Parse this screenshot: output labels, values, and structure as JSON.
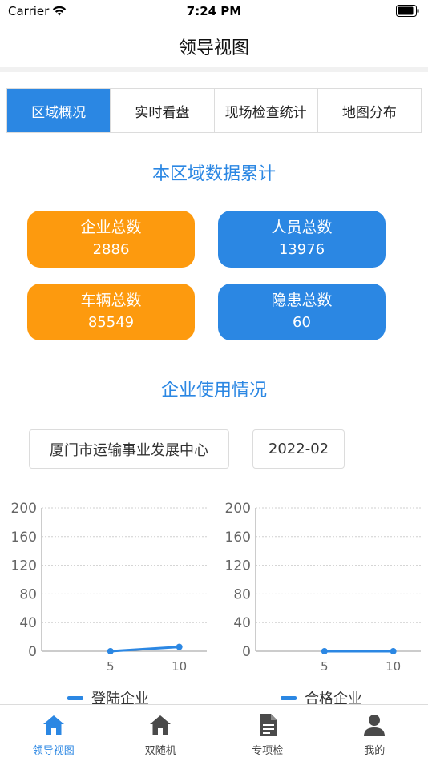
{
  "status_bar": {
    "carrier": "Carrier",
    "time": "7:24 PM"
  },
  "header": {
    "title": "领导视图"
  },
  "tabs": [
    {
      "label": "区域概况",
      "active": true
    },
    {
      "label": "实时看盘",
      "active": false
    },
    {
      "label": "现场检查统计",
      "active": false
    },
    {
      "label": "地图分布",
      "active": false
    }
  ],
  "region_summary": {
    "title": "本区域数据累计",
    "cards": [
      {
        "label": "企业总数",
        "value": "2886",
        "color": "#fd9a0e"
      },
      {
        "label": "人员总数",
        "value": "13976",
        "color": "#2b87e3"
      },
      {
        "label": "车辆总数",
        "value": "85549",
        "color": "#fd9a0e"
      },
      {
        "label": "隐患总数",
        "value": "60",
        "color": "#2b87e3"
      }
    ]
  },
  "usage": {
    "title": "企业使用情况",
    "org_select": "厦门市运输事业发展中心",
    "date_select": "2022-02"
  },
  "colors": {
    "accent": "#2b87e3",
    "orange": "#fd9a0e"
  },
  "chart_data": [
    {
      "type": "line",
      "x": [
        5,
        10
      ],
      "series": [
        {
          "name": "登陆企业",
          "values": [
            0,
            6
          ]
        }
      ],
      "ylim": [
        0,
        200
      ],
      "yticks": [
        0,
        40,
        80,
        120,
        160,
        200
      ],
      "xticks": [
        5,
        10
      ],
      "xrange": [
        0,
        12
      ],
      "grid": true,
      "legend": "bottom"
    },
    {
      "type": "line",
      "x": [
        5,
        10
      ],
      "series": [
        {
          "name": "合格企业",
          "values": [
            0,
            0
          ]
        }
      ],
      "ylim": [
        0,
        200
      ],
      "yticks": [
        0,
        40,
        80,
        120,
        160,
        200
      ],
      "xticks": [
        5,
        10
      ],
      "xrange": [
        0,
        12
      ],
      "grid": true,
      "legend": "bottom"
    }
  ],
  "tab_bar": [
    {
      "label": "领导视图",
      "icon": "home-icon",
      "active": true
    },
    {
      "label": "双随机",
      "icon": "home-icon",
      "active": false
    },
    {
      "label": "专项检",
      "icon": "document-icon",
      "active": false
    },
    {
      "label": "我的",
      "icon": "user-icon",
      "active": false
    }
  ]
}
